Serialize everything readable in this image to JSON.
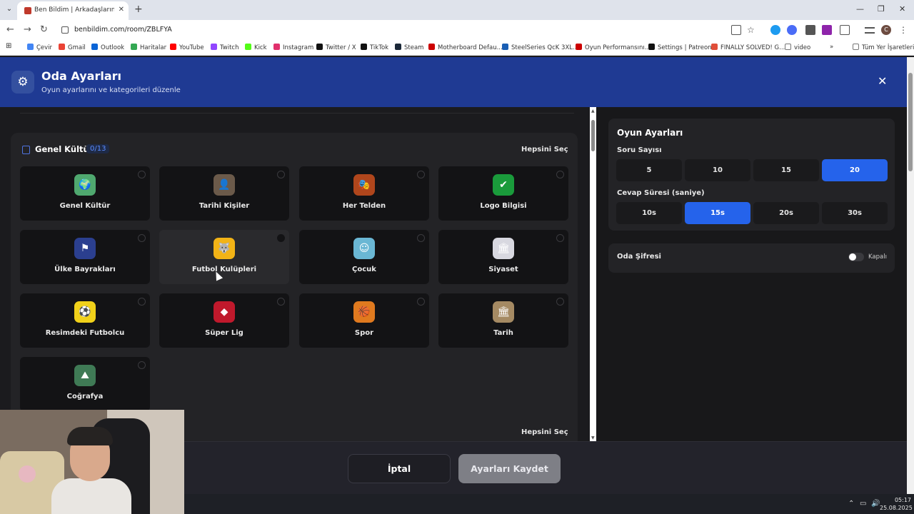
{
  "browser": {
    "tab_title": "Ben Bildim | Arkadaşlarınla Onl",
    "url": "benbildim.com/room/ZBLFYA",
    "tab_close": "✕",
    "new_tab": "+",
    "back": "←",
    "forward": "→",
    "reload": "↻",
    "minimize": "—",
    "restore": "❐",
    "window_close": "✕",
    "bookmarks": [
      {
        "label": "Çevir",
        "color": "#4285f4"
      },
      {
        "label": "Gmail",
        "color": "#ea4335"
      },
      {
        "label": "Outlook",
        "color": "#0a64d6"
      },
      {
        "label": "Haritalar",
        "color": "#34a853"
      },
      {
        "label": "YouTube",
        "color": "#ff0000"
      },
      {
        "label": "Twitch",
        "color": "#9146ff"
      },
      {
        "label": "Kick",
        "color": "#53fc18"
      },
      {
        "label": "Instagram",
        "color": "#e1306c"
      },
      {
        "label": "Twitter / X",
        "color": "#111111"
      },
      {
        "label": "TikTok",
        "color": "#111111"
      },
      {
        "label": "Steam",
        "color": "#1b2838"
      },
      {
        "label": "Motherboard Defau...",
        "color": "#cc0000"
      },
      {
        "label": "SteelSeries QcK 3XL...",
        "color": "#1a5fb4"
      },
      {
        "label": "Oyun Performansını...",
        "color": "#cc0000"
      },
      {
        "label": "Settings | Patreon",
        "color": "#111111"
      },
      {
        "label": "FINALLY SOLVED! G...",
        "color": "#e04e39"
      },
      {
        "label": "video",
        "color": "#777777"
      }
    ],
    "bookmarks_more": "»",
    "all_bookmarks": "Tüm Yer İşaretleri"
  },
  "header": {
    "title": "Oda Ayarları",
    "subtitle": "Oyun ayarlarını ve kategorileri düzenle",
    "close": "✕"
  },
  "section": {
    "title": "Genel Kültür",
    "count": "0/13",
    "select_all": "Hepsini Seç",
    "select_all_bottom": "Hepsini Seç"
  },
  "categories": [
    {
      "label": "Genel Kültür",
      "icon": "earth-icon",
      "glyph": "🌍",
      "bg": "#4fa86f"
    },
    {
      "label": "Tarihi Kişiler",
      "icon": "portrait-icon",
      "glyph": "👤",
      "bg": "#6b5a4a"
    },
    {
      "label": "Her Telden",
      "icon": "mixed-icon",
      "glyph": "🎭",
      "bg": "#b0461c"
    },
    {
      "label": "Logo Bilgisi",
      "icon": "logo-icon",
      "glyph": "✔",
      "bg": "#1a9b3b"
    },
    {
      "label": "Ülke Bayrakları",
      "icon": "flag-icon",
      "glyph": "⚑",
      "bg": "#2b3f8f"
    },
    {
      "label": "Futbol Kulüpleri",
      "icon": "club-crest-icon",
      "glyph": "🐺",
      "bg": "#f2b316"
    },
    {
      "label": "Çocuk",
      "icon": "child-icon",
      "glyph": "☺",
      "bg": "#6ab7d4"
    },
    {
      "label": "Siyaset",
      "icon": "parliament-icon",
      "glyph": "🏛",
      "bg": "#d8d8e0"
    },
    {
      "label": "Resimdeki Futbolcu",
      "icon": "footballer-icon",
      "glyph": "⚽",
      "bg": "#f1d11a"
    },
    {
      "label": "Süper Lig",
      "icon": "league-icon",
      "glyph": "◆",
      "bg": "#c0192c"
    },
    {
      "label": "Spor",
      "icon": "sport-ball-icon",
      "glyph": "🏀",
      "bg": "#e07a1f"
    },
    {
      "label": "Tarih",
      "icon": "colosseum-icon",
      "glyph": "🏛",
      "bg": "#a58a63"
    },
    {
      "label": "Coğrafya",
      "icon": "mountain-icon",
      "glyph": "⛰",
      "bg": "#3f7a55"
    }
  ],
  "game_settings": {
    "title": "Oyun Ayarları",
    "question_count_label": "Soru Sayısı",
    "question_counts": [
      "5",
      "10",
      "15",
      "20"
    ],
    "question_selected": "20",
    "answer_time_label": "Cevap Süresi (saniye)",
    "answer_times": [
      "10s",
      "15s",
      "20s",
      "30s"
    ],
    "answer_selected": "15s"
  },
  "room_password": {
    "label": "Oda Şifresi",
    "state": "Kapalı"
  },
  "footer": {
    "cancel": "İptal",
    "save": "Ayarları Kaydet"
  },
  "taskbar": {
    "time": "05:17",
    "date": "25.08.2025"
  }
}
